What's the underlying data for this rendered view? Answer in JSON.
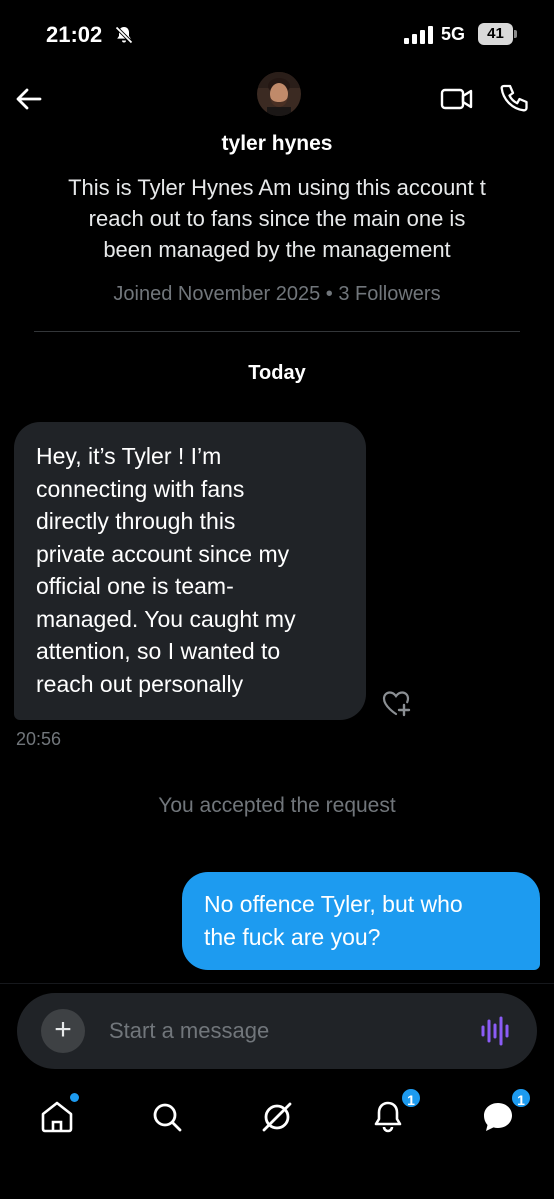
{
  "status_bar": {
    "time": "21:02",
    "network": "5G",
    "battery": "41"
  },
  "header": {
    "name": "tyler hynes",
    "bio": "This is Tyler Hynes Am using this account t\nreach out to fans since the main one is\nbeen managed by the management",
    "meta": "Joined November 2025 • 3 Followers"
  },
  "conversation": {
    "date_label": "Today",
    "messages": [
      {
        "direction": "incoming",
        "text": "Hey, it’s Tyler  ! I’m\nconnecting with fans\ndirectly through this\nprivate account since my\nofficial one is team-\nmanaged. You caught my\nattention, so I wanted to\nreach out personally",
        "time": "20:56"
      },
      {
        "direction": "system",
        "text": "You accepted the request"
      },
      {
        "direction": "outgoing",
        "text": "No offence Tyler, but who\nthe fuck are you?"
      }
    ]
  },
  "composer": {
    "add_label": "+",
    "placeholder": "Start a message"
  },
  "bottom_nav": {
    "notifications_badge": "1",
    "messages_badge": "1"
  },
  "colors": {
    "background": "#000000",
    "accent": "#1d9bf0",
    "incoming_bubble": "#202327",
    "muted_text": "#71767b",
    "voice_icon": "#8b5cf6"
  },
  "icons": [
    "bell-off-icon",
    "signal-icon",
    "battery-icon",
    "back-arrow-icon",
    "video-icon",
    "phone-icon",
    "heart-plus-icon",
    "plus-icon",
    "voice-wave-icon",
    "home-icon",
    "search-icon",
    "grok-icon",
    "notifications-icon",
    "messages-icon"
  ]
}
